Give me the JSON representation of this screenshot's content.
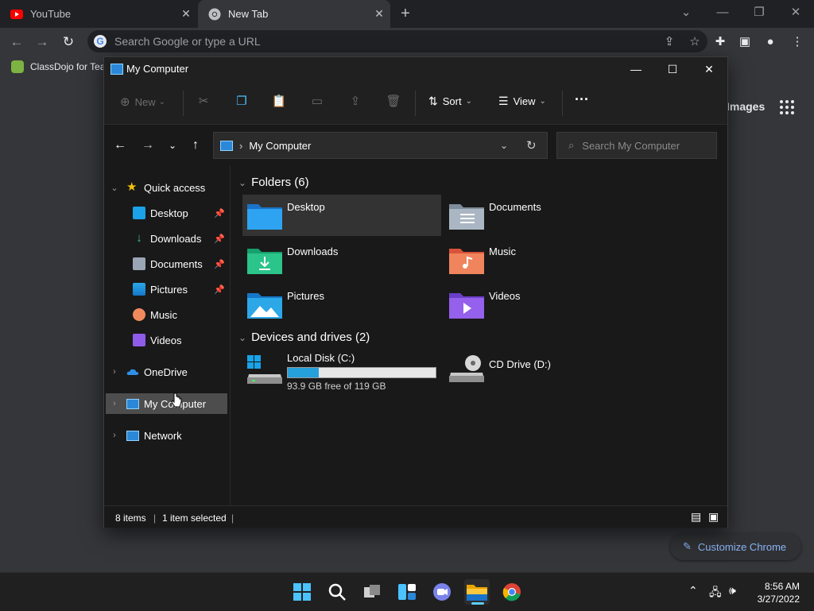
{
  "browser": {
    "tabs": [
      {
        "title": "YouTube",
        "favicon": "youtube-icon",
        "active": false
      },
      {
        "title": "New Tab",
        "favicon": "chrome-icon",
        "active": true
      }
    ],
    "omnibox": {
      "placeholder": "Search Google or type a URL"
    },
    "bookmarks": [
      {
        "label": "ClassDojo for Tea"
      }
    ],
    "new_tab_page": {
      "images_link": "Images",
      "customize_label": "Customize Chrome"
    }
  },
  "explorer": {
    "title": "My Computer",
    "commands": {
      "new": "New",
      "sort": "Sort",
      "view": "View",
      "more": "···"
    },
    "address": {
      "path": "My Computer"
    },
    "search": {
      "placeholder": "Search My Computer"
    },
    "nav": {
      "quick_access": "Quick access",
      "quick_items": [
        {
          "label": "Desktop",
          "pinned": true
        },
        {
          "label": "Downloads",
          "pinned": true
        },
        {
          "label": "Documents",
          "pinned": true
        },
        {
          "label": "Pictures",
          "pinned": true
        },
        {
          "label": "Music",
          "pinned": false
        },
        {
          "label": "Videos",
          "pinned": false
        }
      ],
      "onedrive": "OneDrive",
      "my_computer": "My Computer",
      "network": "Network"
    },
    "folders_header": "Folders (6)",
    "folders": [
      {
        "name": "Desktop",
        "icon": "desktop-folder-icon",
        "selected": true
      },
      {
        "name": "Documents",
        "icon": "documents-folder-icon",
        "selected": false
      },
      {
        "name": "Downloads",
        "icon": "downloads-folder-icon",
        "selected": false
      },
      {
        "name": "Music",
        "icon": "music-folder-icon",
        "selected": false
      },
      {
        "name": "Pictures",
        "icon": "pictures-folder-icon",
        "selected": false
      },
      {
        "name": "Videos",
        "icon": "videos-folder-icon",
        "selected": false
      }
    ],
    "drives_header": "Devices and drives (2)",
    "drives": [
      {
        "name": "Local Disk (C:)",
        "free_text": "93.9 GB free of 119 GB",
        "used_fraction": 0.21
      },
      {
        "name": "CD Drive (D:)"
      }
    ],
    "status": {
      "items": "8 items",
      "selected": "1 item selected"
    }
  },
  "taskbar": {
    "time": "8:56 AM",
    "date": "3/27/2022"
  },
  "colors": {
    "accent": "#60cdff",
    "drive_bar": "#26a0da",
    "chrome_link": "#8ab4f8"
  }
}
